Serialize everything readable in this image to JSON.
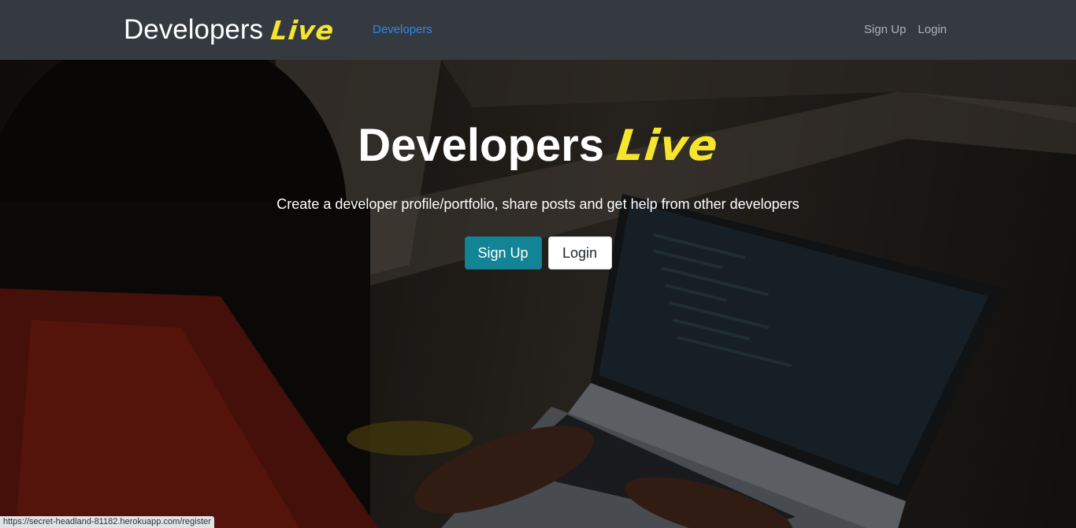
{
  "navbar": {
    "brand_main": "Developers",
    "brand_accent": "Live",
    "developers_link": "Developers",
    "signup_link": "Sign Up",
    "login_link": "Login"
  },
  "hero": {
    "title_main": "Developers",
    "title_accent": "Live",
    "subtitle": "Create a developer profile/portfolio, share posts and get help from other developers",
    "signup_button": "Sign Up",
    "login_button": "Login"
  },
  "status_bar": {
    "url": "https://secret-headland-81182.herokuapp.com/register"
  },
  "colors": {
    "navbar_bg": "#343a40",
    "accent_yellow": "#f5e52e",
    "link_blue": "#2f86f0",
    "signup_teal": "#138496"
  }
}
